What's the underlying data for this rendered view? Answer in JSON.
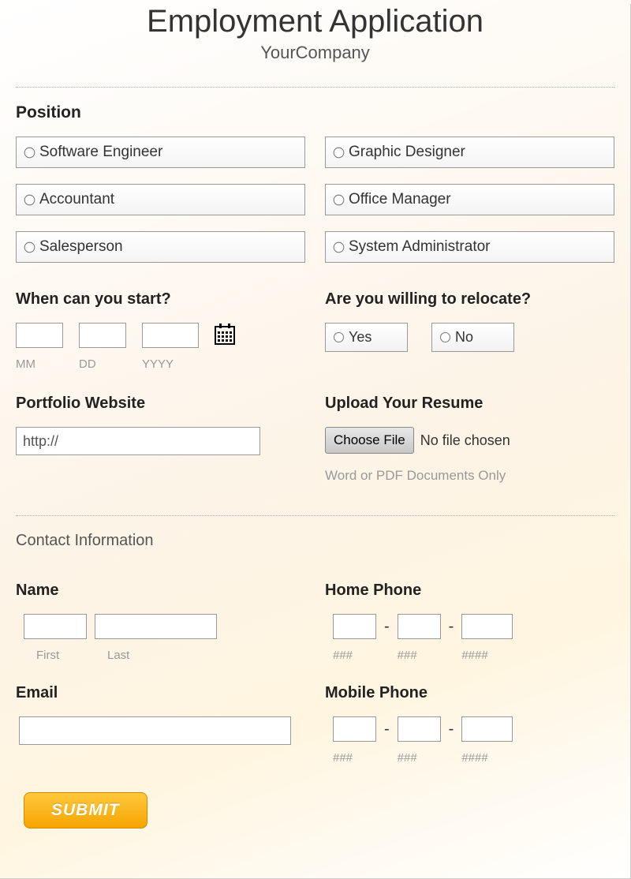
{
  "header": {
    "title": "Employment Application",
    "subtitle": "YourCompany"
  },
  "position": {
    "label": "Position",
    "options": [
      "Software Engineer",
      "Graphic Designer",
      "Accountant",
      "Office Manager",
      "Salesperson",
      "System Administrator"
    ]
  },
  "start_date": {
    "label": "When can you start?",
    "mm": "MM",
    "dd": "DD",
    "yyyy": "YYYY"
  },
  "relocate": {
    "label": "Are you willing to relocate?",
    "yes": "Yes",
    "no": "No"
  },
  "portfolio": {
    "label": "Portfolio Website",
    "value": "http://"
  },
  "resume": {
    "label": "Upload Your Resume",
    "button": "Choose File",
    "status": "No file chosen",
    "hint": "Word or PDF Documents Only"
  },
  "contact": {
    "heading": "Contact Information",
    "name": {
      "label": "Name",
      "first": "First",
      "last": "Last"
    },
    "home_phone": {
      "label": "Home Phone",
      "p1": "###",
      "p2": "###",
      "p3": "####",
      "dash": "-"
    },
    "email": {
      "label": "Email"
    },
    "mobile_phone": {
      "label": "Mobile Phone",
      "p1": "###",
      "p2": "###",
      "p3": "####",
      "dash": "-"
    }
  },
  "submit": "SUBMIT"
}
